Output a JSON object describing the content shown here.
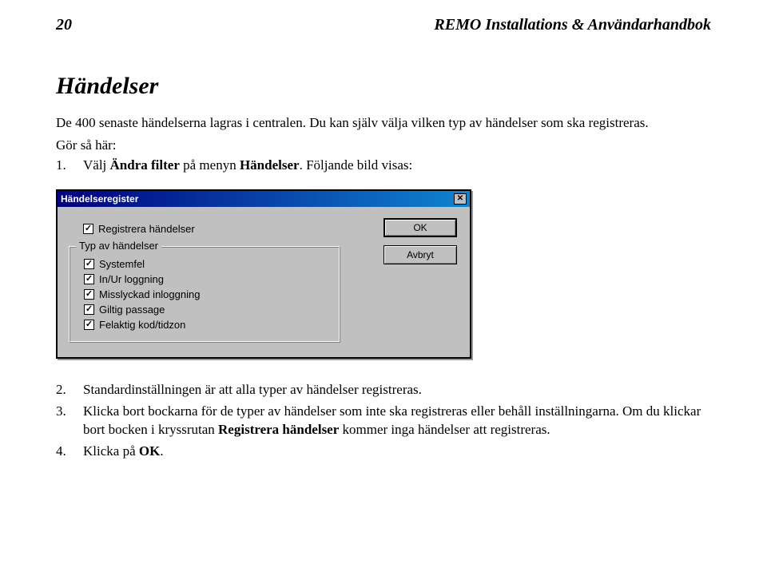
{
  "header": {
    "page_number": "20",
    "title": "REMO Installations & Användarhandbok"
  },
  "section": {
    "heading": "Händelser",
    "intro": "De 400 senaste händelserna lagras i centralen. Du kan själv välja vilken typ av händelser som ska registreras.",
    "howto_label": "Gör så här:",
    "steps_before": [
      {
        "n": "1.",
        "pre": "Välj ",
        "bold": "Ändra filter",
        "mid": " på menyn ",
        "bold2": "Händelser",
        "post": ". Följande bild visas:"
      }
    ],
    "steps_after": [
      {
        "n": "2.",
        "text": "Standardinställningen är att alla typer av händelser registreras."
      },
      {
        "n": "3.",
        "pre": "Klicka bort bockarna för de typer av händelser som inte ska registreras eller behåll inställningarna. Om du klickar bort bocken i kryssrutan ",
        "bold": "Registrera händelser",
        "post": " kommer inga händelser att registreras."
      },
      {
        "n": "4.",
        "pre": "Klicka på ",
        "bold": "OK",
        "post": "."
      }
    ]
  },
  "dialog": {
    "title": "Händelseregister",
    "close_glyph": "✕",
    "top_checkbox": "Registrera händelser",
    "group_label": "Typ av händelser",
    "options": [
      "Systemfel",
      "In/Ur loggning",
      "Misslyckad inloggning",
      "Giltig passage",
      "Felaktig kod/tidzon"
    ],
    "ok_label": "OK",
    "cancel_label": "Avbryt"
  }
}
